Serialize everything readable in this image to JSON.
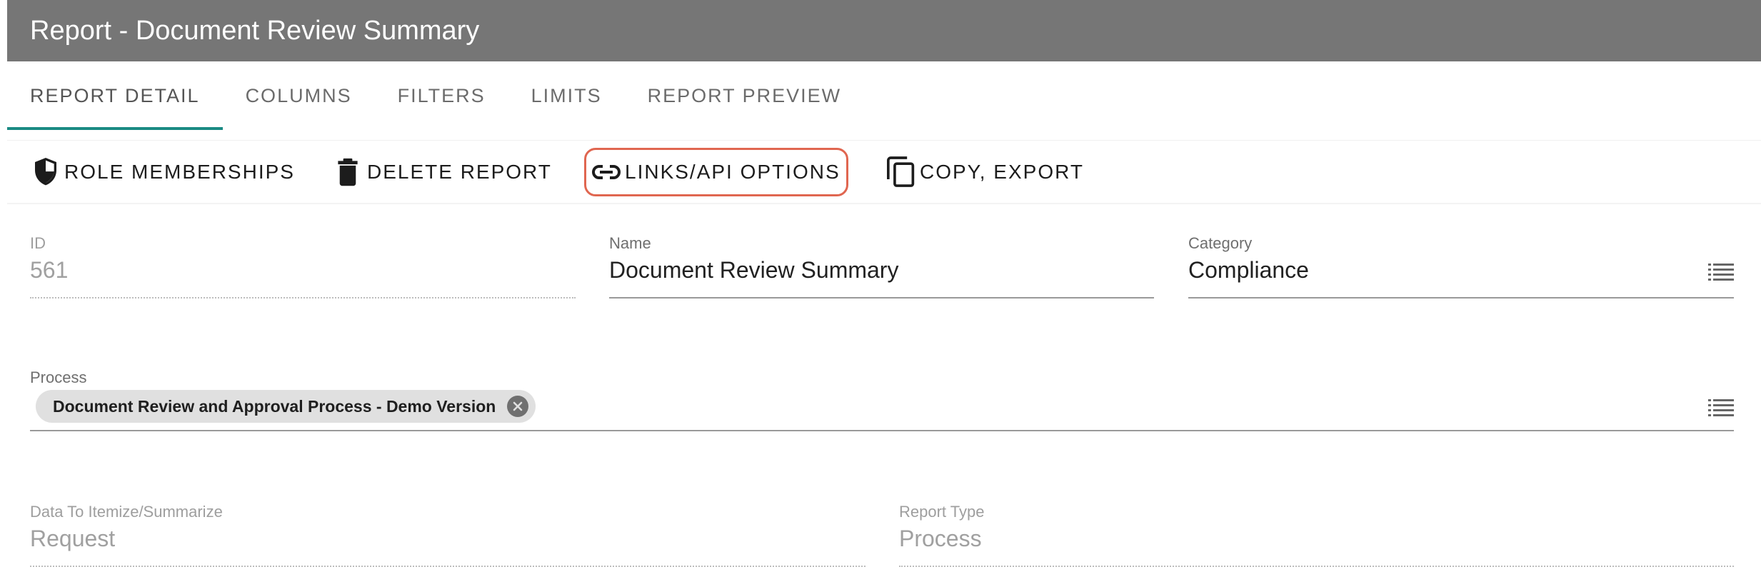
{
  "window": {
    "title": "Report - Document Review Summary"
  },
  "tabs": [
    {
      "label": "REPORT DETAIL",
      "active": true
    },
    {
      "label": "COLUMNS",
      "active": false
    },
    {
      "label": "FILTERS",
      "active": false
    },
    {
      "label": "LIMITS",
      "active": false
    },
    {
      "label": "REPORT PREVIEW",
      "active": false
    }
  ],
  "toolbar": {
    "role_memberships": {
      "label": "ROLE MEMBERSHIPS",
      "icon": "shield-icon"
    },
    "delete_report": {
      "label": "DELETE REPORT",
      "icon": "trash-icon"
    },
    "links_api": {
      "label": "LINKS/API OPTIONS",
      "icon": "link-icon",
      "highlighted": true
    },
    "copy_export": {
      "label": "COPY, EXPORT",
      "icon": "copy-icon"
    }
  },
  "form": {
    "id": {
      "label": "ID",
      "value": "561"
    },
    "name": {
      "label": "Name",
      "value": "Document Review Summary"
    },
    "category": {
      "label": "Category",
      "value": "Compliance",
      "icon": "list-icon"
    },
    "process": {
      "label": "Process",
      "chip": "Document Review and Approval Process - Demo Version",
      "icon": "list-icon"
    },
    "data_to_itemize": {
      "label": "Data To Itemize/Summarize",
      "value": "Request"
    },
    "report_type": {
      "label": "Report Type",
      "value": "Process"
    }
  },
  "colors": {
    "titlebar": "#767676",
    "active_tab_indicator": "#1a8a83",
    "highlight_outline": "#e06650",
    "chip_background": "#e0e0e0"
  }
}
